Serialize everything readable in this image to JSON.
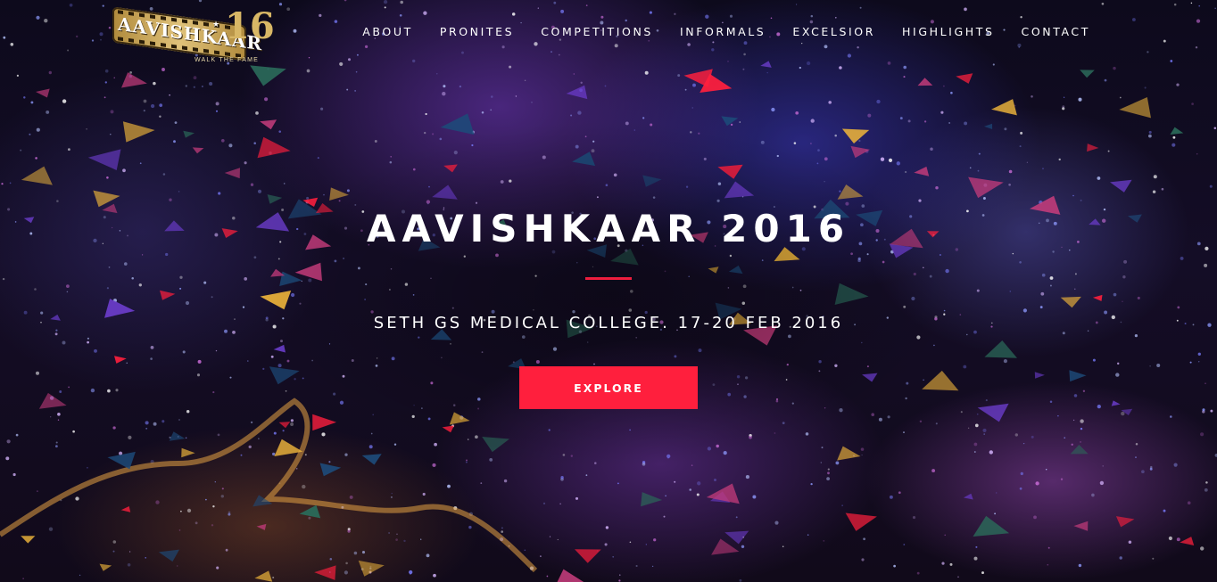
{
  "brand": {
    "logo_text": "AAVISHKAAR",
    "logo_number": "16",
    "logo_tagline": "WALK THE FAME"
  },
  "nav": {
    "items": [
      "ABOUT",
      "PRONITES",
      "COMPETITIONS",
      "INFORMALS",
      "EXCELSIOR",
      "HIGHLIGHTS",
      "CONTACT"
    ]
  },
  "hero": {
    "title": "AAVISHKAAR 2016",
    "subtitle": "SETH GS MEDICAL COLLEGE. 17-20 FEB 2016",
    "cta_label": "EXPLORE"
  },
  "colors": {
    "accent": "#ff1f3d",
    "divider": "#ee1d3e",
    "text": "#ffffff",
    "logo_gold": "#d8b766"
  }
}
